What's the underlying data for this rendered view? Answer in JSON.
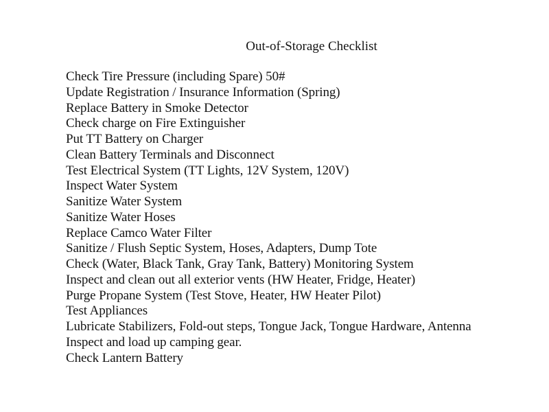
{
  "document": {
    "title": "Out-of-Storage Checklist",
    "items": [
      "Check Tire Pressure (including Spare) 50#",
      "Update Registration / Insurance Information (Spring)",
      "Replace Battery in Smoke Detector",
      "Check charge on Fire Extinguisher",
      "Put TT Battery on Charger",
      "Clean Battery Terminals and Disconnect",
      "Test Electrical System (TT Lights, 12V System, 120V)",
      "Inspect Water System",
      "Sanitize Water System",
      "Sanitize Water Hoses",
      "Replace Camco Water Filter",
      "Sanitize / Flush Septic System, Hoses, Adapters, Dump Tote",
      "Check (Water, Black Tank, Gray Tank, Battery) Monitoring System",
      "Inspect and clean out all exterior vents (HW Heater, Fridge, Heater)",
      "Purge Propane System (Test Stove, Heater, HW Heater Pilot)",
      "Test Appliances",
      "Lubricate Stabilizers, Fold-out steps, Tongue Jack, Tongue Hardware, Antenna",
      "Inspect and load up camping gear.",
      "Check Lantern Battery"
    ]
  }
}
